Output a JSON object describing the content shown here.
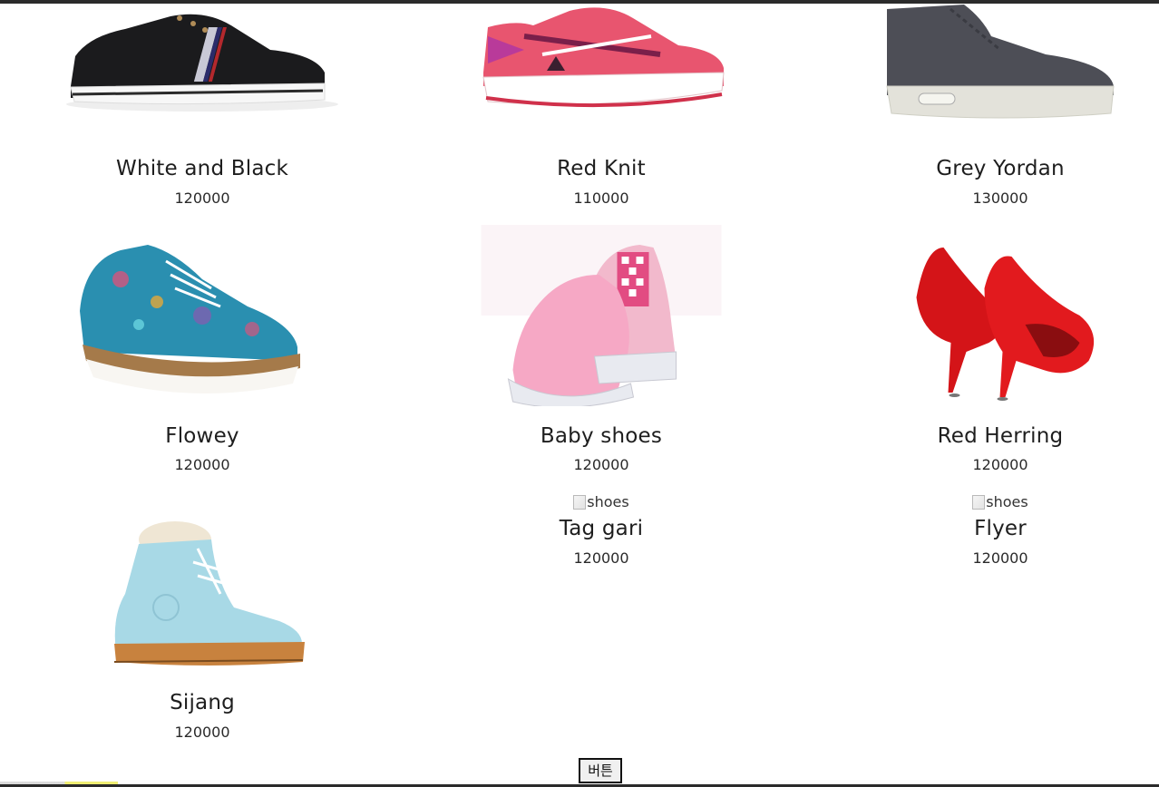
{
  "products": [
    {
      "name": "White and Black",
      "price": "120000",
      "icon": "sneaker-black-white-image"
    },
    {
      "name": "Red Knit",
      "price": "110000",
      "icon": "running-shoe-pink-image"
    },
    {
      "name": "Grey Yordan",
      "price": "130000",
      "icon": "high-top-grey-image"
    },
    {
      "name": "Flowey",
      "price": "120000",
      "icon": "floral-oxford-image"
    },
    {
      "name": "Baby shoes",
      "price": "120000",
      "icon": "pink-slip-on-image"
    },
    {
      "name": "Red Herring",
      "price": "120000",
      "icon": "red-heels-image"
    },
    {
      "name": "Sijang",
      "price": "120000",
      "icon": "blue-boot-image"
    },
    {
      "name": "Tag gari",
      "price": "120000",
      "alt": "shoes"
    },
    {
      "name": "Flyer",
      "price": "120000",
      "alt": "shoes"
    }
  ],
  "button": {
    "label": "버튼"
  },
  "colors": {
    "page_bg": "#ffffff",
    "top_bar": "#2b2b2b",
    "text": "#1e1e1e"
  }
}
